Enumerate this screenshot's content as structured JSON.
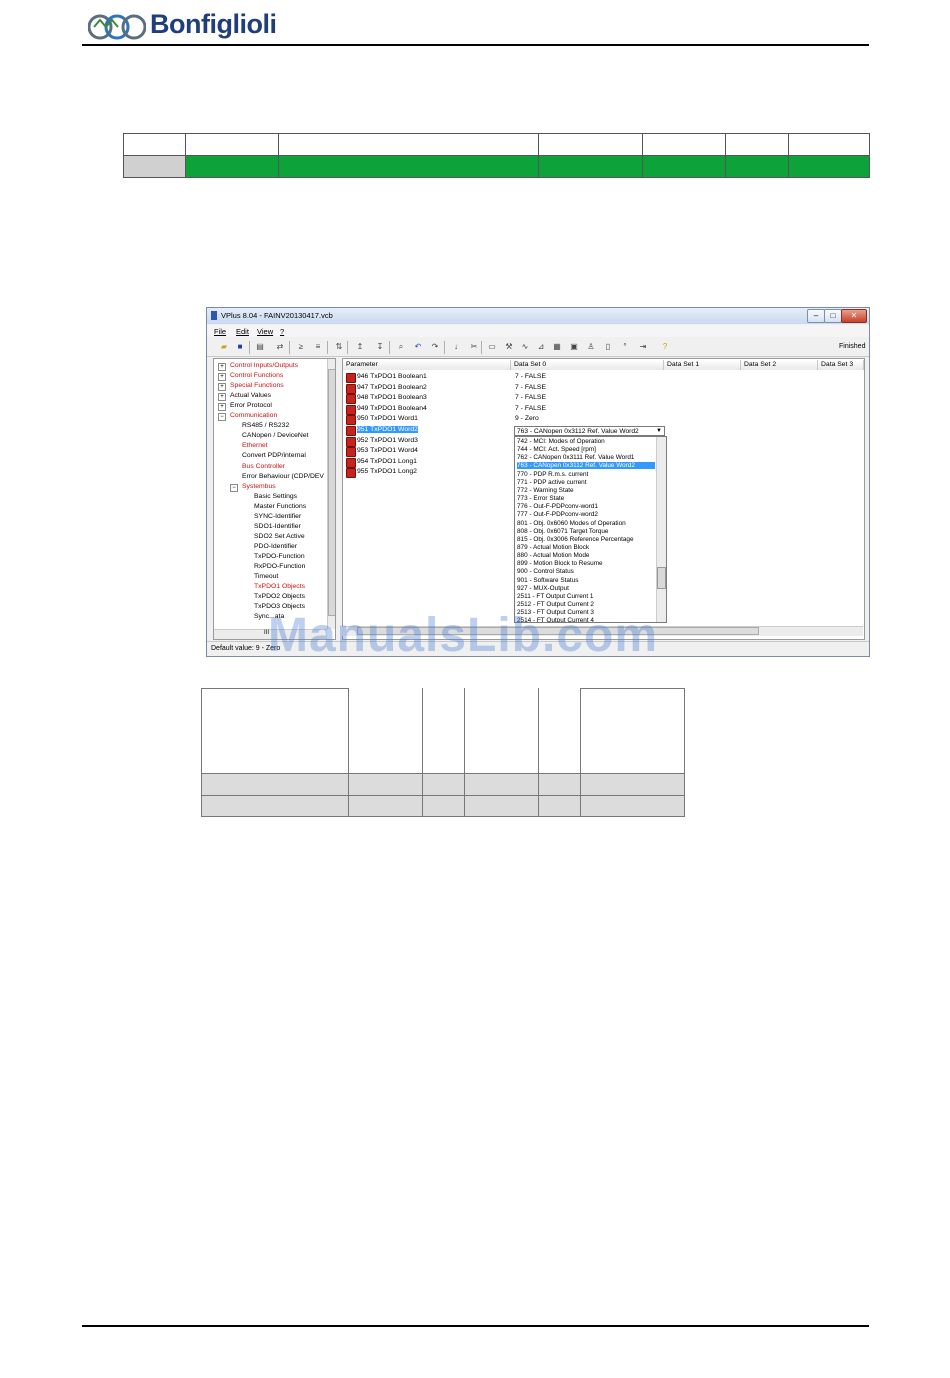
{
  "header": {
    "brand": "Bonfiglioli"
  },
  "top_table": {
    "rows": 2,
    "cols": 7
  },
  "window": {
    "title": "VPlus 8.04 - FAINV20130417.vcb",
    "controls": {
      "minimize": "–",
      "maximize": "□",
      "close": "✕"
    },
    "menu": [
      "File",
      "Edit",
      "View",
      "?"
    ],
    "toolbar_status": "Finished",
    "tree": [
      {
        "label": "Control Inputs/Outputs",
        "red": true,
        "level": 0,
        "exp": "+"
      },
      {
        "label": "Control Functions",
        "red": true,
        "level": 0,
        "exp": "+"
      },
      {
        "label": "Special Functions",
        "red": true,
        "level": 0,
        "exp": "+"
      },
      {
        "label": "Actual Values",
        "red": false,
        "level": 0,
        "exp": "+"
      },
      {
        "label": "Error Protocol",
        "red": false,
        "level": 0,
        "exp": "+"
      },
      {
        "label": "Communication",
        "red": true,
        "level": 0,
        "exp": "−"
      },
      {
        "label": "RS485 / RS232",
        "red": false,
        "level": 1,
        "exp": ""
      },
      {
        "label": "CANopen / DeviceNet",
        "red": false,
        "level": 1,
        "exp": ""
      },
      {
        "label": "Ethernet",
        "red": true,
        "level": 1,
        "exp": ""
      },
      {
        "label": "Convert PDP/internal",
        "red": false,
        "level": 1,
        "exp": ""
      },
      {
        "label": "Bus Controller",
        "red": true,
        "level": 1,
        "exp": ""
      },
      {
        "label": "Error Behaviour (CDP/DEV",
        "red": false,
        "level": 1,
        "exp": ""
      },
      {
        "label": "Systembus",
        "red": true,
        "level": 1,
        "exp": "−"
      },
      {
        "label": "Basic Settings",
        "red": false,
        "level": 2,
        "exp": ""
      },
      {
        "label": "Master Functions",
        "red": false,
        "level": 2,
        "exp": ""
      },
      {
        "label": "SYNC-Identifier",
        "red": false,
        "level": 2,
        "exp": ""
      },
      {
        "label": "SDO1-Identifier",
        "red": false,
        "level": 2,
        "exp": ""
      },
      {
        "label": "SDO2 Set Active",
        "red": false,
        "level": 2,
        "exp": ""
      },
      {
        "label": "PDO-Identifier",
        "red": false,
        "level": 2,
        "exp": ""
      },
      {
        "label": "TxPDO-Function",
        "red": false,
        "level": 2,
        "exp": ""
      },
      {
        "label": "RxPDO-Function",
        "red": false,
        "level": 2,
        "exp": ""
      },
      {
        "label": "Timeout",
        "red": false,
        "level": 2,
        "exp": ""
      },
      {
        "label": "TxPDO1 Objects",
        "red": true,
        "level": 2,
        "exp": ""
      },
      {
        "label": "TxPDO2 Objects",
        "red": false,
        "level": 2,
        "exp": ""
      },
      {
        "label": "TxPDO3 Objects",
        "red": false,
        "level": 2,
        "exp": ""
      },
      {
        "label": "Sync...ata",
        "red": false,
        "level": 2,
        "exp": ""
      }
    ],
    "tree_scroll_label": "III",
    "grid_headers": [
      "Parameter",
      "Data Set 0",
      "Data Set 1",
      "Data Set 2",
      "Data Set 3"
    ],
    "grid_rows": [
      {
        "param": "946  TxPDO1 Boolean1",
        "value": "7 - FALSE",
        "selected": false
      },
      {
        "param": "947  TxPDO1 Boolean2",
        "value": "7 - FALSE",
        "selected": false
      },
      {
        "param": "948  TxPDO1 Boolean3",
        "value": "7 - FALSE",
        "selected": false
      },
      {
        "param": "949  TxPDO1 Boolean4",
        "value": "7 - FALSE",
        "selected": false
      },
      {
        "param": "950  TxPDO1 Word1",
        "value": "9 - Zero",
        "selected": false
      },
      {
        "param": "951  TxPDO1 Word2",
        "value": "",
        "selected": true
      },
      {
        "param": "952  TxPDO1 Word3",
        "value": "",
        "selected": false
      },
      {
        "param": "953  TxPDO1 Word4",
        "value": "",
        "selected": false
      },
      {
        "param": "954  TxPDO1 Long1",
        "value": "",
        "selected": false
      },
      {
        "param": "955  TxPDO1 Long2",
        "value": "",
        "selected": false
      }
    ],
    "combo_value": "763 - CANopen 0x3112 Ref. Value Word2",
    "dropdown_items": [
      {
        "label": "742 - MCI: Modes of Operation",
        "selected": false
      },
      {
        "label": "744 - MCI: Act. Speed [rpm]",
        "selected": false
      },
      {
        "label": "762 - CANopen 0x3111 Ref. Value Word1",
        "selected": false
      },
      {
        "label": "763 - CANopen 0x3112 Ref. Value Word2",
        "selected": true
      },
      {
        "label": "770 - PDP R.m.s. current",
        "selected": false
      },
      {
        "label": "771 - PDP active current",
        "selected": false
      },
      {
        "label": "772 - Warning State",
        "selected": false
      },
      {
        "label": "773 - Error State",
        "selected": false
      },
      {
        "label": "776 - Out-F-PDPconv-word1",
        "selected": false
      },
      {
        "label": "777 - Out-F-PDPconv-word2",
        "selected": false
      },
      {
        "label": "801 - Obj. 0x6060 Modes of Operation",
        "selected": false
      },
      {
        "label": "808 - Obj. 0x6071 Target Torque",
        "selected": false
      },
      {
        "label": "815 - Obj. 0x3006 Reference Percentage",
        "selected": false
      },
      {
        "label": "879 - Actual Motion Block",
        "selected": false
      },
      {
        "label": "880 - Actual Motion Mode",
        "selected": false
      },
      {
        "label": "899 - Motion Block to Resume",
        "selected": false
      },
      {
        "label": "900 - Control Status",
        "selected": false
      },
      {
        "label": "901 - Software Status",
        "selected": false
      },
      {
        "label": "927 - MUX-Output",
        "selected": false
      },
      {
        "label": "2511 - FT Output Current 1",
        "selected": false
      },
      {
        "label": "2512 - FT Output Current 2",
        "selected": false
      },
      {
        "label": "2513 - FT Output Current 3",
        "selected": false
      },
      {
        "label": "2514 - FT Output Current 4",
        "selected": false
      }
    ],
    "status_text": "Default value: 9 - Zero"
  },
  "watermark": "ManualsLib.com",
  "colors": {
    "green": "#0ea33a",
    "selection": "#3399ff",
    "tree_red": "#d01010",
    "brand_blue": "#1f3e7a"
  }
}
